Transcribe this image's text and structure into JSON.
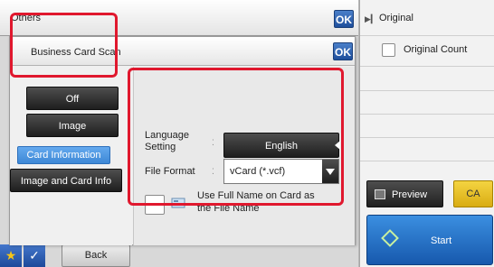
{
  "others": {
    "title": "Others",
    "ok_label": "OK"
  },
  "dialog": {
    "title": "Business Card Scan",
    "ok_label": "OK",
    "buttons": {
      "off": "Off",
      "image": "Image",
      "card_info": "Card Information",
      "image_and_card_info": "Image and Card Info"
    },
    "language": {
      "label": "Language Setting",
      "value": "English"
    },
    "file_format": {
      "label": "File Format",
      "value": "vCard (*.vcf)"
    },
    "full_name_option": {
      "label": "Use Full Name on Card as the File Name",
      "checked": false
    }
  },
  "right_panel": {
    "original_label": "Original",
    "original_count_label": "Original Count",
    "preview_label": "Preview",
    "ca_label": "CA",
    "start_label": "Start"
  },
  "bottom_bar": {
    "back_label": "Back"
  },
  "colors": {
    "highlight_red": "#e0182e",
    "selected_blue": "#4a94e0",
    "ok_blue": "#2a5fb0",
    "start_blue": "#2a74c8",
    "ca_yellow": "#e8c02a"
  }
}
